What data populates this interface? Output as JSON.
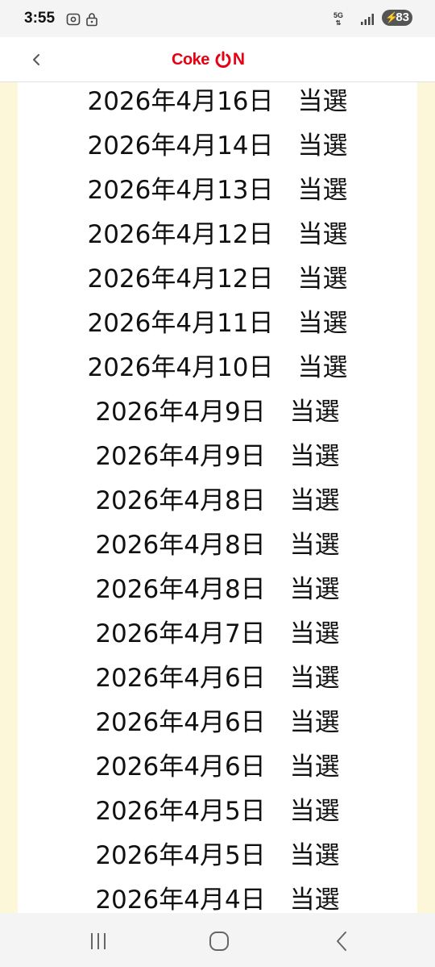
{
  "status_bar": {
    "time": "3:55",
    "network": "5G",
    "battery": "83"
  },
  "header": {
    "brand_main": "Coke",
    "brand_on_suffix": "N",
    "brand_color": "#e60012"
  },
  "colors": {
    "side_background": "#fdf7d9",
    "panel_background": "#ffffff",
    "text": "#111111"
  },
  "entries": [
    {
      "date": "2026年4月16日",
      "status": "当選"
    },
    {
      "date": "2026年4月14日",
      "status": "当選"
    },
    {
      "date": "2026年4月13日",
      "status": "当選"
    },
    {
      "date": "2026年4月12日",
      "status": "当選"
    },
    {
      "date": "2026年4月12日",
      "status": "当選"
    },
    {
      "date": "2026年4月11日",
      "status": "当選"
    },
    {
      "date": "2026年4月10日",
      "status": "当選"
    },
    {
      "date": "2026年4月9日",
      "status": "当選"
    },
    {
      "date": "2026年4月9日",
      "status": "当選"
    },
    {
      "date": "2026年4月8日",
      "status": "当選"
    },
    {
      "date": "2026年4月8日",
      "status": "当選"
    },
    {
      "date": "2026年4月8日",
      "status": "当選"
    },
    {
      "date": "2026年4月7日",
      "status": "当選"
    },
    {
      "date": "2026年4月6日",
      "status": "当選"
    },
    {
      "date": "2026年4月6日",
      "status": "当選"
    },
    {
      "date": "2026年4月6日",
      "status": "当選"
    },
    {
      "date": "2026年4月5日",
      "status": "当選"
    },
    {
      "date": "2026年4月5日",
      "status": "当選"
    },
    {
      "date": "2026年4月4日",
      "status": "当選"
    }
  ],
  "icons": {
    "status_left": [
      "screenshot-icon",
      "lock-icon"
    ],
    "status_right": [
      "network-5g-icon",
      "signal-icon",
      "battery-charging-icon"
    ],
    "header": [
      "back-chevron-icon",
      "power-icon"
    ],
    "nav": [
      "recent-apps-icon",
      "home-icon",
      "back-icon"
    ]
  }
}
